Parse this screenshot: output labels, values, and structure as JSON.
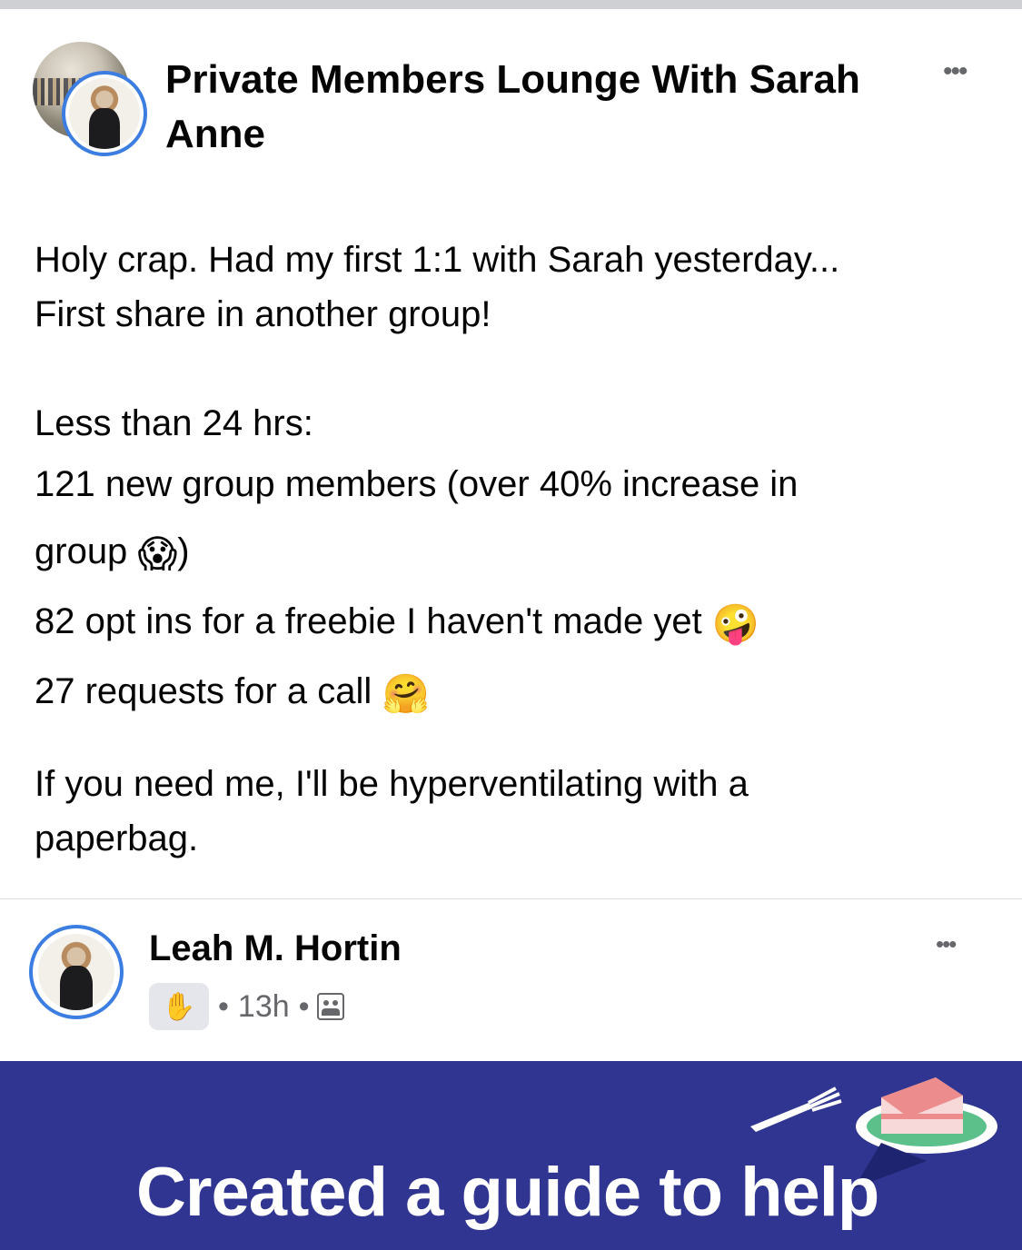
{
  "group": {
    "name": "Private Members Lounge With Sarah Anne"
  },
  "post": {
    "lines": [
      "Holy crap. Had my first 1:1 with Sarah yesterday...",
      "First share in another group!",
      "Less than 24 hrs:",
      "121 new group members (over 40% increase in",
      "group",
      ")",
      "82 opt ins for a freebie I haven't made yet",
      "27 requests for a call",
      "If you need me, I'll be hyperventilating with a",
      "paperbag."
    ],
    "emojis": {
      "scream": "😱",
      "zany": "🤪",
      "hug": "🤗"
    }
  },
  "shared_post": {
    "author": "Leah M. Hortin",
    "badge_icon": "✋",
    "time": "13h",
    "separator": "•",
    "banner_text": "Created a guide to help"
  },
  "menu": {
    "more": "•••"
  },
  "colors": {
    "accent": "#3b7de0",
    "banner_bg": "#2f3590",
    "meta_gray": "#65676b"
  }
}
